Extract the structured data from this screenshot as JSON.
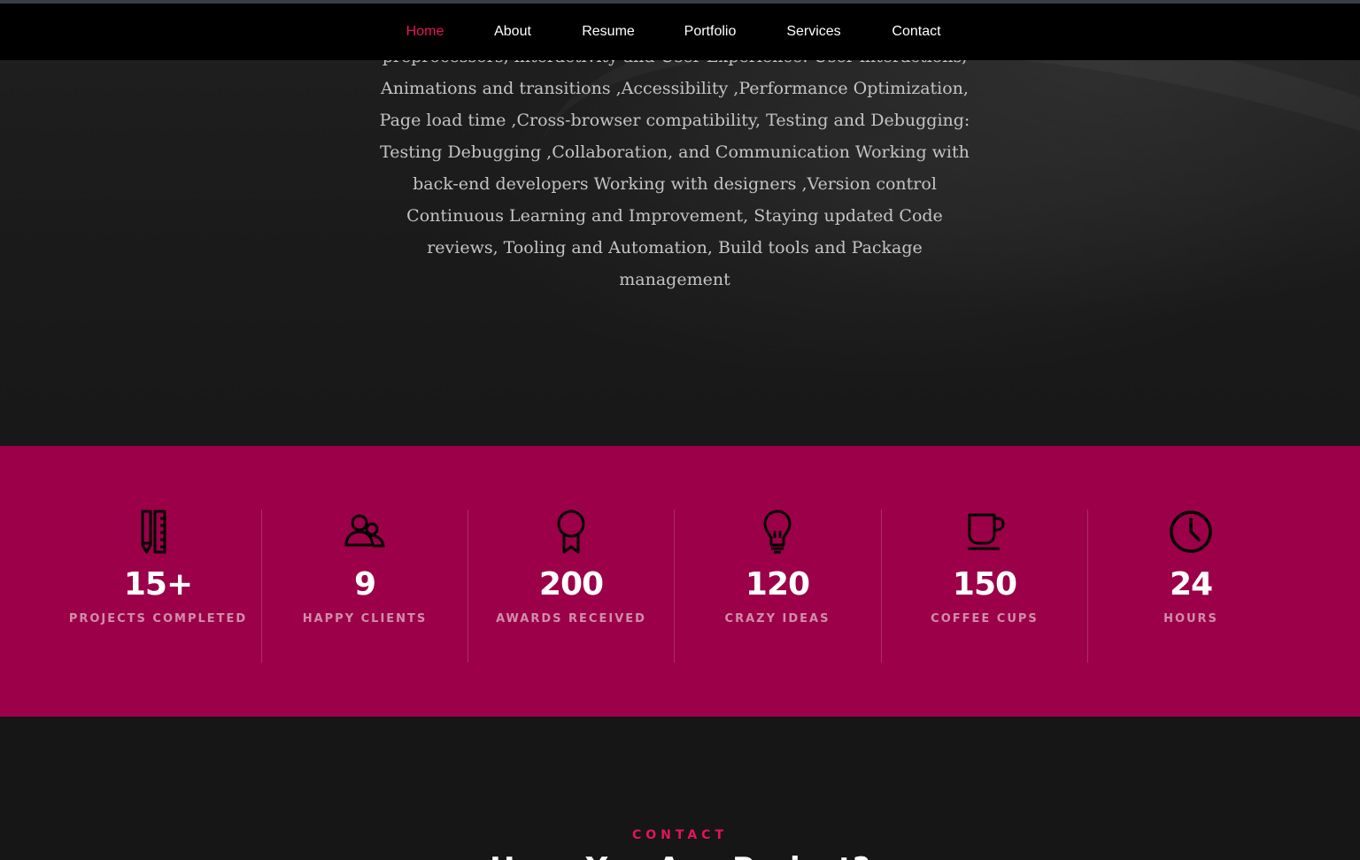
{
  "nav": {
    "items": [
      {
        "label": "Home",
        "active": true
      },
      {
        "label": "About"
      },
      {
        "label": "Resume"
      },
      {
        "label": "Portfolio"
      },
      {
        "label": "Services"
      },
      {
        "label": "Contact"
      }
    ]
  },
  "hero": {
    "text": "preprocessors, interactivity and User Experience: User interactions, Animations and transitions ,Accessibility ,Performance Optimization, Page load time ,Cross-browser compatibility, Testing and Debugging: Testing Debugging ,Collaboration, and Communication Working with back-end developers Working with designers ,Version control Continuous Learning and Improvement, Staying updated Code reviews, Tooling and Automation, Build tools and Package management"
  },
  "stats": {
    "items": [
      {
        "icon": "pencil-ruler-icon",
        "value": "15+",
        "label": "PROJECTS COMPLETED"
      },
      {
        "icon": "users-icon",
        "value": "9",
        "label": "HAPPY CLIENTS"
      },
      {
        "icon": "award-icon",
        "value": "200",
        "label": "AWARDS RECEIVED"
      },
      {
        "icon": "lightbulb-icon",
        "value": "120",
        "label": "CRAZY IDEAS"
      },
      {
        "icon": "coffee-cup-icon",
        "value": "150",
        "label": "COFFEE CUPS"
      },
      {
        "icon": "clock-icon",
        "value": "24",
        "label": "HOURS"
      }
    ]
  },
  "contact": {
    "eyebrow": "CONTACT",
    "title": "Have You Any Project?"
  },
  "colors": {
    "accent": "#e3145a",
    "stats_bg": "#9b0048",
    "nav_bg": "#000000",
    "page_bg": "#161616"
  }
}
